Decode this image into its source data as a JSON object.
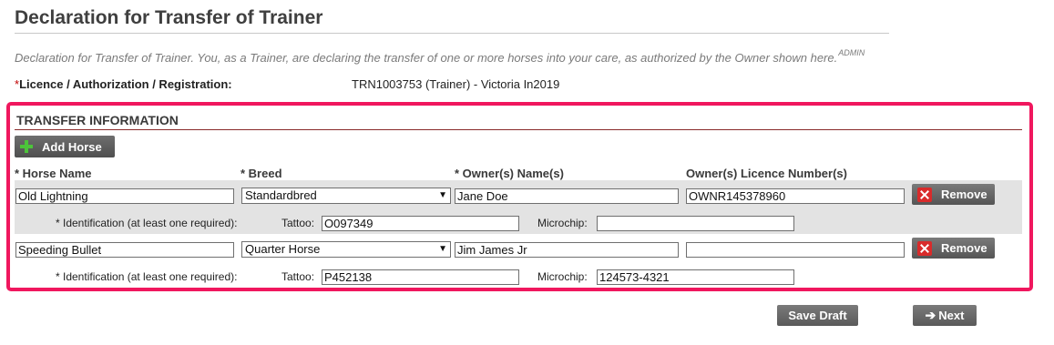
{
  "page": {
    "title": "Declaration for Transfer of Trainer",
    "description": "Declaration for Transfer of Trainer. You, as a Trainer, are declaring the transfer of one or more horses into your care, as authorized by the Owner shown here.",
    "description_superscript": "ADMIN"
  },
  "licence": {
    "required_marker": "*",
    "label": "Licence / Authorization / Registration:",
    "value": "TRN1003753 (Trainer) - Victoria In2019"
  },
  "transfer": {
    "section_title": "TRANSFER INFORMATION",
    "add_button_label": "Add Horse",
    "add_icon": "plus-icon",
    "remove_icon": "close-x-icon",
    "columns": {
      "horse_name": "* Horse Name",
      "breed": "* Breed",
      "owner_names": "* Owner(s) Name(s)",
      "owner_licence": "Owner(s) Licence Number(s)"
    },
    "identification_label": "* Identification (at least one required):",
    "tattoo_label": "Tattoo:",
    "microchip_label": "Microchip:",
    "remove_label": "Remove",
    "horses": [
      {
        "name": "Old Lightning",
        "breed": "Standardbred",
        "owner_name": "Jane Doe",
        "owner_licence": "OWNR145378960",
        "tattoo": "O097349",
        "microchip": ""
      },
      {
        "name": "Speeding Bullet",
        "breed": "Quarter Horse",
        "owner_name": "Jim James Jr",
        "owner_licence": "",
        "tattoo": "P452138",
        "microchip": "124573-4321"
      }
    ]
  },
  "footer": {
    "save_draft_label": "Save Draft",
    "next_label": "Next",
    "next_icon": "arrow-right-icon"
  },
  "colors": {
    "highlight_border": "#f0175e",
    "button_gray": "#5f5f5f",
    "row_stripe": "#e3e3e3",
    "required_red": "#c00000"
  }
}
